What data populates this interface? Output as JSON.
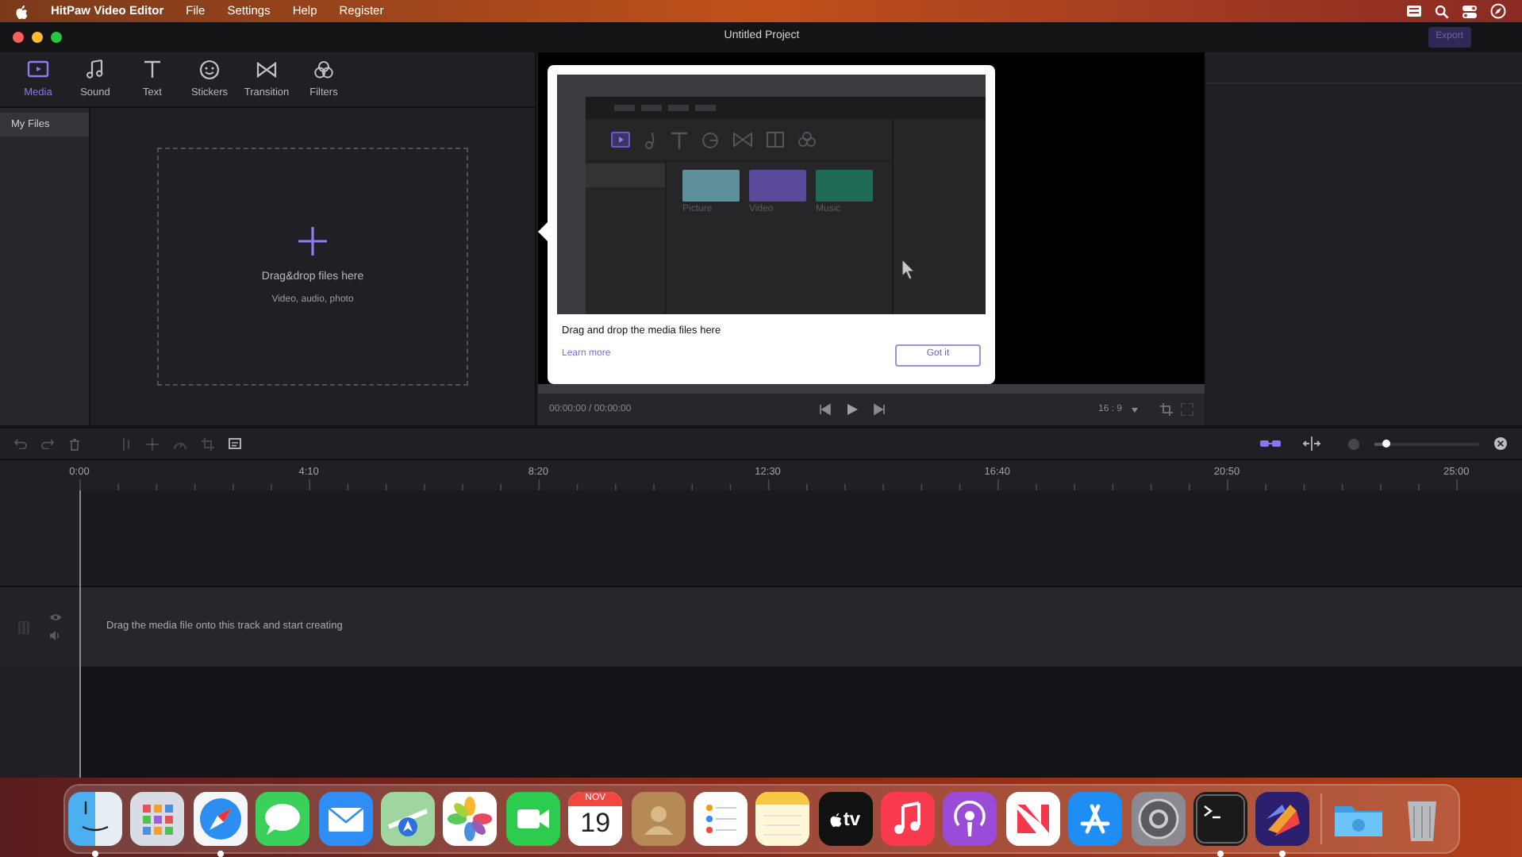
{
  "menu_bar": {
    "app_name": "HitPaw Video Editor",
    "menus": [
      "File",
      "Settings",
      "Help",
      "Register"
    ]
  },
  "window": {
    "title": "Untitled Project",
    "export_button": {
      "label": "Export",
      "disabled": true
    }
  },
  "media_tabs": [
    {
      "kind": "media",
      "label": "Media",
      "selected": true
    },
    {
      "kind": "sound",
      "label": "Sound",
      "selected": false
    },
    {
      "kind": "text",
      "label": "Text",
      "selected": false
    },
    {
      "kind": "stickers",
      "label": "Stickers",
      "selected": false
    },
    {
      "kind": "transition",
      "label": "Transition",
      "selected": false
    },
    {
      "kind": "filters",
      "label": "Filters",
      "selected": false
    }
  ],
  "sidebar": {
    "items": [
      {
        "label": "My Files",
        "selected": true
      }
    ]
  },
  "drop_zone": {
    "title": "Drag&drop files here",
    "subtitle": "Video, audio, photo"
  },
  "tooltip": {
    "illustration": {
      "thumbnails": [
        {
          "label": "Picture",
          "color": "#5f8f9a"
        },
        {
          "label": "Video",
          "color": "#5b4a9a"
        },
        {
          "label": "Music",
          "color": "#1f6b55"
        }
      ]
    },
    "message": "Drag and drop the media files here",
    "link": "Learn more",
    "button": "Got it"
  },
  "player": {
    "timecode": "00:00:00 / 00:00:00",
    "aspect_ratio": "16 : 9"
  },
  "timeline": {
    "ruler_labels": [
      "0:00",
      "4:10",
      "8:20",
      "12:30",
      "16:40",
      "20:50",
      "25:00"
    ],
    "zoom": {
      "level": 0.1
    },
    "hint": "Drag the media file onto this track and start creating"
  },
  "dock": {
    "items": [
      {
        "kind": "finder",
        "running": true
      },
      {
        "kind": "launchpad",
        "running": false
      },
      {
        "kind": "safari",
        "running": true
      },
      {
        "kind": "messages",
        "running": false
      },
      {
        "kind": "mail",
        "running": false
      },
      {
        "kind": "maps",
        "running": false
      },
      {
        "kind": "photos",
        "running": false
      },
      {
        "kind": "facetime",
        "running": false
      },
      {
        "kind": "calendar",
        "running": false,
        "month": "NOV",
        "day": "19"
      },
      {
        "kind": "contacts",
        "running": false
      },
      {
        "kind": "reminders",
        "running": false
      },
      {
        "kind": "notes",
        "running": false
      },
      {
        "kind": "tv",
        "running": false,
        "label": "tv"
      },
      {
        "kind": "music",
        "running": false
      },
      {
        "kind": "podcasts",
        "running": false
      },
      {
        "kind": "news",
        "running": false
      },
      {
        "kind": "appstore",
        "running": false
      },
      {
        "kind": "settings",
        "running": false
      },
      {
        "kind": "terminal",
        "running": true
      },
      {
        "kind": "hitpaw",
        "running": true
      },
      {
        "kind": "separator"
      },
      {
        "kind": "folder",
        "running": false
      },
      {
        "kind": "trash",
        "running": false
      }
    ]
  }
}
